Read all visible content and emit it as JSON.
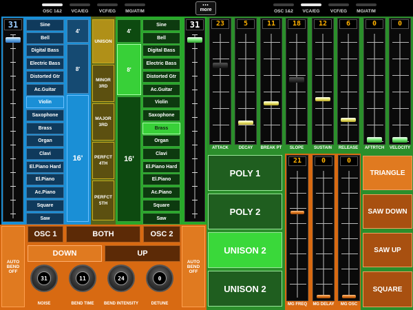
{
  "top_tabs_left": [
    "OSC 1&2",
    "VCA/EG",
    "VCF/EG",
    "MG/AT/M"
  ],
  "top_tabs_right": [
    "OSC 1&2",
    "VCA/EG",
    "VCF/EG",
    "MG/AT/M"
  ],
  "more_label": "more",
  "more_dots": "•••",
  "osc1": {
    "level_display": "31",
    "waveforms": [
      "Sine",
      "Bell",
      "Digital Bass",
      "Electric Bass",
      "Distorted Gtr",
      "Ac.Guitar",
      "Violin",
      "Saxophone",
      "Brass",
      "Organ",
      "Clavi",
      "El.Piano Hard",
      "El.Piano",
      "Ac.Piano",
      "Square",
      "Saw"
    ],
    "selected": "Violin",
    "octaves": [
      "4'",
      "8'",
      "16'"
    ],
    "selected_octave": "16'"
  },
  "intervals": [
    "UNISON",
    "MINOR 3RD",
    "MAJOR 3RD",
    "PERFCT 4TH",
    "PERFCT 5TH"
  ],
  "osc2": {
    "level_display": "31",
    "waveforms": [
      "Sine",
      "Bell",
      "Digital Bass",
      "Electric Bass",
      "Distorted Gtr",
      "Ac.Guitar",
      "Violin",
      "Saxophone",
      "Brass",
      "Organ",
      "Clavi",
      "El.Piano Hard",
      "El.Piano",
      "Ac.Piano",
      "Square",
      "Saw"
    ],
    "selected": "Brass",
    "octaves": [
      "4'",
      "8'",
      "16'"
    ],
    "selected_octave": "8'"
  },
  "envelope": [
    {
      "label": "ATTACK",
      "value": "23",
      "level": 0.72
    },
    {
      "label": "DECAY",
      "value": "5",
      "level": 0.16
    },
    {
      "label": "BREAK PT",
      "value": "11",
      "level": 0.35
    },
    {
      "label": "SLOPE",
      "value": "18",
      "level": 0.58
    },
    {
      "label": "SUSTAIN",
      "value": "12",
      "level": 0.39
    },
    {
      "label": "RELEASE",
      "value": "6",
      "level": 0.19
    },
    {
      "label": "AFTRTCH",
      "value": "0",
      "level": 0.0
    },
    {
      "label": "VELOCITY",
      "value": "0",
      "level": 0.0
    }
  ],
  "voice_modes": [
    {
      "label": "POLY 1",
      "on": false
    },
    {
      "label": "POLY 2",
      "on": false
    },
    {
      "label": "UNISON 2",
      "on": true
    },
    {
      "label": "UNISON 2",
      "on": false
    }
  ],
  "mg": [
    {
      "label": "MG FREQ",
      "value": "21",
      "level": 0.68
    },
    {
      "label": "MG DELAY",
      "value": "0",
      "level": 0.0
    },
    {
      "label": "MG OSC",
      "value": "0",
      "level": 0.0
    }
  ],
  "mg_waveforms": [
    {
      "label": "TRIANGLE",
      "sel": true
    },
    {
      "label": "SAW DOWN",
      "sel": false
    },
    {
      "label": "SAW UP",
      "sel": false
    },
    {
      "label": "SQUARE",
      "sel": false
    }
  ],
  "bend": {
    "auto_left": "AUTO BEND OFF",
    "auto_right": "AUTO BEND OFF",
    "targets": [
      "OSC 1",
      "BOTH",
      "OSC 2"
    ],
    "directions": [
      "DOWN",
      "UP"
    ],
    "selected_direction": "DOWN",
    "knobs": [
      {
        "label": "NOISE",
        "value": "31"
      },
      {
        "label": "BEND TIME",
        "value": "11"
      },
      {
        "label": "BEND INTENSITY",
        "value": "24"
      },
      {
        "label": "DETUNE",
        "value": "0"
      }
    ]
  }
}
